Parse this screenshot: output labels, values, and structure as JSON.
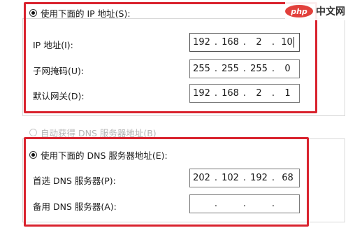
{
  "ip_section": {
    "use_following_label": "使用下面的 IP 地址(S):",
    "fields": [
      {
        "label": "IP 地址(I):",
        "octets": [
          "192",
          "168",
          "2",
          "10"
        ]
      },
      {
        "label": "子网掩码(U):",
        "octets": [
          "255",
          "255",
          "255",
          "0"
        ]
      },
      {
        "label": "默认网关(D):",
        "octets": [
          "192",
          "168",
          "2",
          "1"
        ]
      }
    ]
  },
  "dns_section": {
    "auto_label": "自动获得 DNS 服务器地址(B)",
    "use_following_label": "使用下面的 DNS 服务器地址(E):",
    "fields": [
      {
        "label": "首选 DNS 服务器(P):",
        "octets": [
          "202",
          "102",
          "192",
          "68"
        ]
      },
      {
        "label": "备用 DNS 服务器(A):",
        "octets": [
          "",
          "",
          "",
          ""
        ]
      }
    ]
  },
  "watermark": {
    "logo": "php",
    "text": "中文网"
  },
  "colors": {
    "highlight_border": "#d9232e"
  }
}
